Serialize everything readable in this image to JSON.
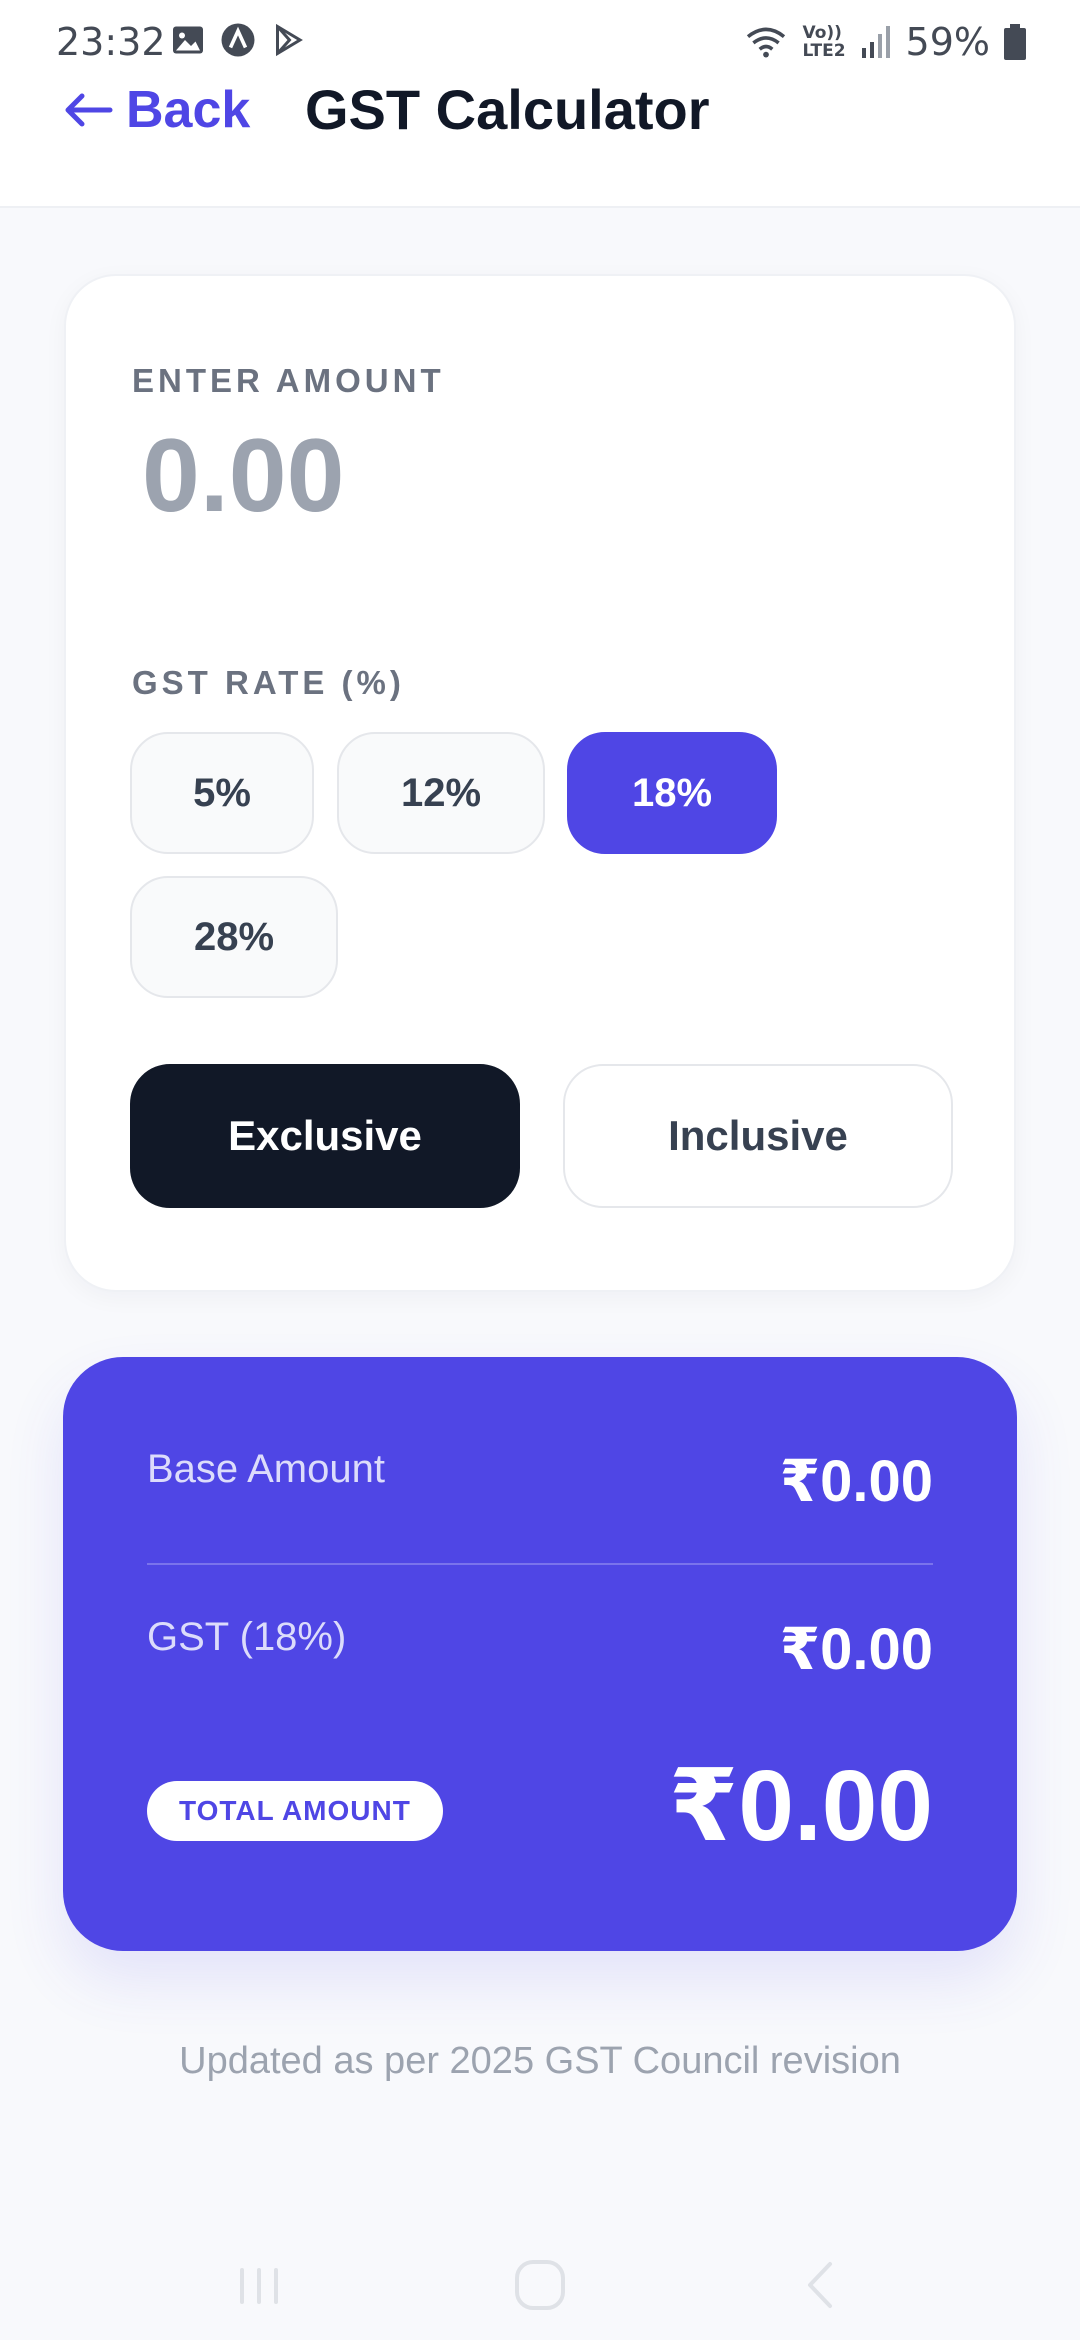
{
  "status_bar": {
    "time": "23:32",
    "battery_text": "59%",
    "icons_left": [
      "gallery-icon",
      "app-a-icon",
      "play-store-icon"
    ],
    "icons_right": [
      "wifi-icon",
      "volte-icon",
      "signal-icon",
      "battery-icon"
    ],
    "network_label_top": "Vo))",
    "network_label_bottom": "LTE2"
  },
  "header": {
    "back_label": "Back",
    "title": "GST Calculator"
  },
  "input_card": {
    "amount_label": "ENTER AMOUNT",
    "amount_value": "",
    "amount_placeholder": "0.00",
    "rate_label": "GST RATE (%)",
    "rates": [
      "5%",
      "12%",
      "18%",
      "28%"
    ],
    "selected_rate": "18%",
    "modes": [
      "Exclusive",
      "Inclusive"
    ],
    "selected_mode": "Exclusive"
  },
  "results": {
    "base_label": "Base Amount",
    "base_value": "₹0.00",
    "gst_label": "GST (18%)",
    "gst_value": "₹0.00",
    "total_label": "TOTAL AMOUNT",
    "total_value": "₹0.00"
  },
  "footer": {
    "note": "Updated as per 2025 GST Council revision"
  },
  "colors": {
    "accent": "#4f46e5",
    "dark": "#111827",
    "background": "#f8f9fc",
    "muted": "#9ca3af"
  }
}
